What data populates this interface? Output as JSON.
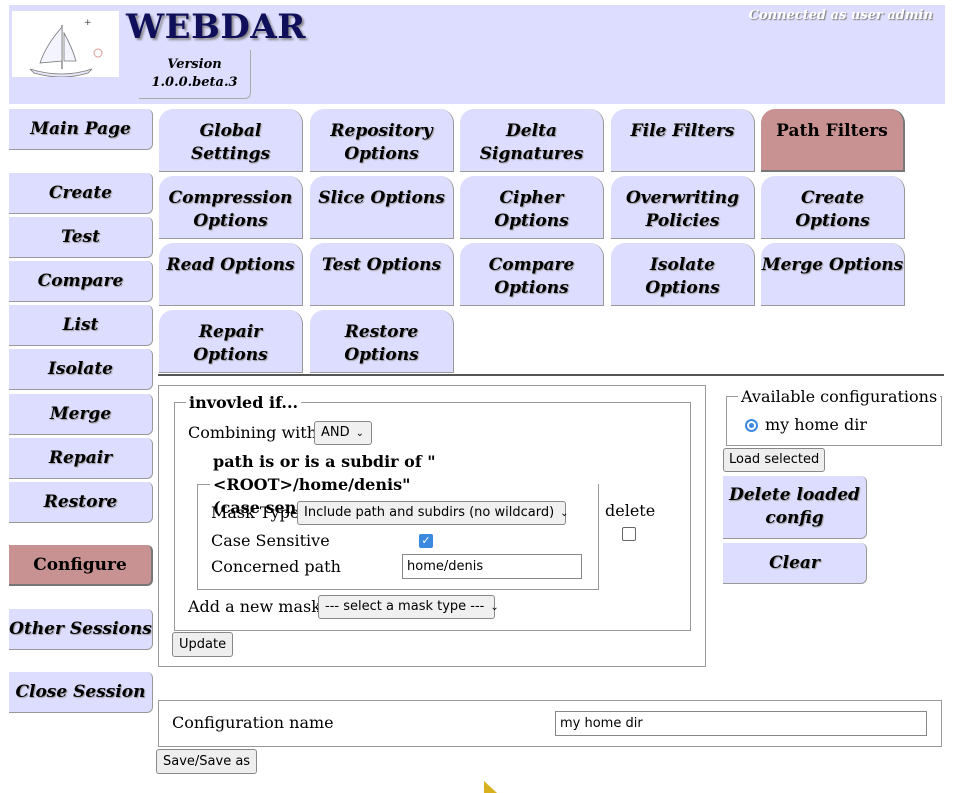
{
  "header": {
    "app_title": "WEBDAR",
    "version_label": "Version",
    "version_number": "1.0.0.beta.3",
    "connection_status": "Connected as user admin"
  },
  "sidebar": {
    "items": [
      {
        "label": "Main Page",
        "active": false
      },
      {
        "label": "Create",
        "active": false
      },
      {
        "label": "Test",
        "active": false
      },
      {
        "label": "Compare",
        "active": false
      },
      {
        "label": "List",
        "active": false
      },
      {
        "label": "Isolate",
        "active": false
      },
      {
        "label": "Merge",
        "active": false
      },
      {
        "label": "Repair",
        "active": false
      },
      {
        "label": "Restore",
        "active": false
      },
      {
        "label": "Configure",
        "active": true
      },
      {
        "label": "Other Sessions",
        "active": false
      },
      {
        "label": "Close Session",
        "active": false
      }
    ]
  },
  "tabs": [
    {
      "line1": "Global Settings",
      "line2": "",
      "active": false
    },
    {
      "line1": "Repository",
      "line2": "Options",
      "active": false
    },
    {
      "line1": "Delta",
      "line2": "Signatures",
      "active": false
    },
    {
      "line1": "File Filters",
      "line2": "",
      "active": false
    },
    {
      "line1": "Path Filters",
      "line2": "",
      "active": true
    },
    {
      "line1": "Compression",
      "line2": "Options",
      "active": false
    },
    {
      "line1": "Slice Options",
      "line2": "",
      "active": false
    },
    {
      "line1": "Cipher Options",
      "line2": "",
      "active": false
    },
    {
      "line1": "Overwriting",
      "line2": "Policies",
      "active": false
    },
    {
      "line1": "Create Options",
      "line2": "",
      "active": false
    },
    {
      "line1": "Read Options",
      "line2": "",
      "active": false
    },
    {
      "line1": "Test Options",
      "line2": "",
      "active": false
    },
    {
      "line1": "Compare",
      "line2": "Options",
      "active": false
    },
    {
      "line1": "Isolate Options",
      "line2": "",
      "active": false
    },
    {
      "line1": "Merge Options",
      "line2": "",
      "active": false
    },
    {
      "line1": "Repair Options",
      "line2": "",
      "active": false
    },
    {
      "line1": "Restore",
      "line2": "Options",
      "active": false
    }
  ],
  "filter": {
    "legend": "invovled if...",
    "combining_label": "Combining with",
    "combining_value": "AND",
    "mask": {
      "legend_line1": "path is or is a subdir of \"<ROOT>/home/denis\"",
      "legend_line2": "(case sensitive)",
      "mask_type_label": "Mask Type",
      "mask_type_value": "Include path and subdirs (no wildcard)",
      "case_sensitive_label": "Case Sensitive",
      "case_sensitive_checked": true,
      "concerned_path_label": "Concerned path",
      "concerned_path_value": "home/denis"
    },
    "delete_label": "delete",
    "delete_checked": false,
    "add_mask_label": "Add a new mask",
    "add_mask_value": "--- select a mask type ---",
    "update_label": "Update"
  },
  "configs": {
    "legend": "Available configurations",
    "items": [
      {
        "label": "my home dir",
        "selected": true
      }
    ],
    "load_label": "Load selected",
    "delete_line1": "Delete loaded",
    "delete_line2": "config",
    "clear_label": "Clear"
  },
  "config_name": {
    "label": "Configuration name",
    "value": "my home dir",
    "save_label": "Save/Save as"
  },
  "colors": {
    "header_bg": "#ddddff",
    "button_bg": "#ddddff",
    "active_bg": "#c99292",
    "title_color": "#10105a",
    "accent": "#3b8ae0"
  }
}
